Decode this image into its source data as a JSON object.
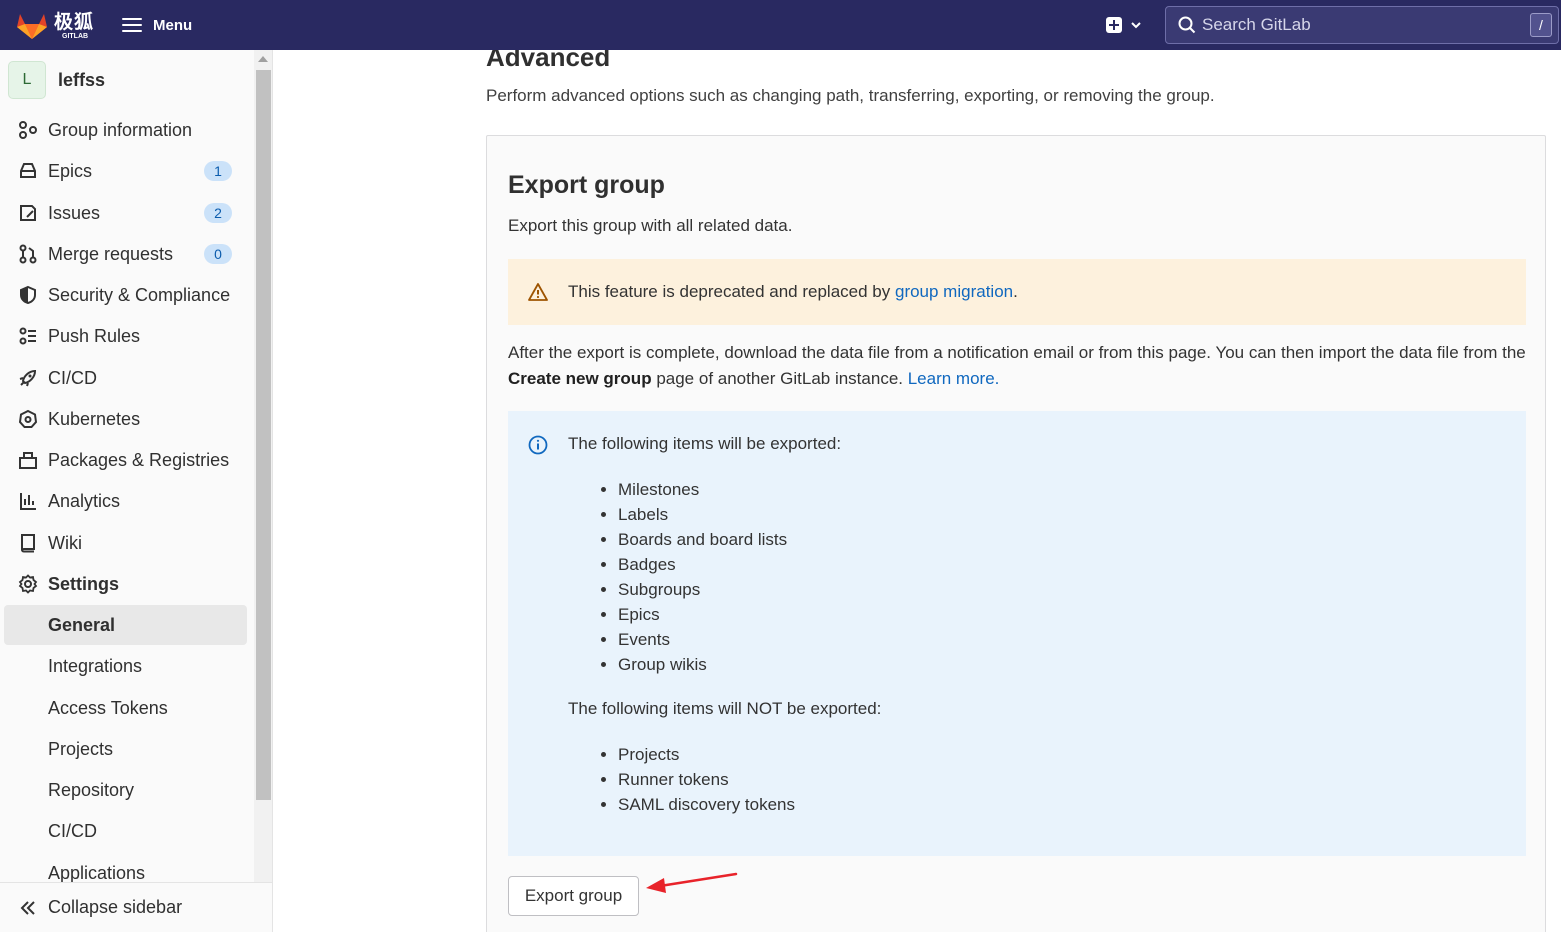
{
  "topbar": {
    "brand_cn": "极狐",
    "brand_en": "GITLAB",
    "menu_label": "Menu",
    "search_placeholder": "Search GitLab",
    "search_shortcut": "/"
  },
  "sidebar": {
    "group_initial": "L",
    "group_name": "leffss",
    "items": [
      {
        "label": "Group information",
        "icon": "group-information-icon"
      },
      {
        "label": "Epics",
        "badge": "1",
        "icon": "epic-icon"
      },
      {
        "label": "Issues",
        "badge": "2",
        "icon": "issues-icon"
      },
      {
        "label": "Merge requests",
        "badge": "0",
        "icon": "merge-request-icon"
      },
      {
        "label": "Security & Compliance",
        "icon": "shield-icon"
      },
      {
        "label": "Push Rules",
        "icon": "push-rules-icon"
      },
      {
        "label": "CI/CD",
        "icon": "rocket-icon"
      },
      {
        "label": "Kubernetes",
        "icon": "kubernetes-icon"
      },
      {
        "label": "Packages & Registries",
        "icon": "package-icon"
      },
      {
        "label": "Analytics",
        "icon": "chart-icon"
      },
      {
        "label": "Wiki",
        "icon": "book-icon"
      },
      {
        "label": "Settings",
        "icon": "settings-icon"
      }
    ],
    "sub_items": [
      {
        "label": "General"
      },
      {
        "label": "Integrations"
      },
      {
        "label": "Access Tokens"
      },
      {
        "label": "Projects"
      },
      {
        "label": "Repository"
      },
      {
        "label": "CI/CD"
      },
      {
        "label": "Applications"
      }
    ],
    "collapse_label": "Collapse sidebar"
  },
  "main": {
    "section_title": "Advanced",
    "section_desc": "Perform advanced options such as changing path, transferring, exporting, or removing the group.",
    "card": {
      "title": "Export group",
      "desc": "Export this group with all related data.",
      "warning_text": "This feature is deprecated and replaced by ",
      "warning_link": "group migration",
      "warning_end": ".",
      "para_1": "After the export is complete, download the data file from a notification email or from this page. You can then import the data file from the ",
      "para_bold": "Create new group",
      "para_2": " page of another GitLab instance. ",
      "para_link": "Learn more.",
      "exported_head": "The following items will be exported:",
      "exported": [
        "Milestones",
        "Labels",
        "Boards and board lists",
        "Badges",
        "Subgroups",
        "Epics",
        "Events",
        "Group wikis"
      ],
      "not_exported_head": "The following items will NOT be exported:",
      "not_exported": [
        "Projects",
        "Runner tokens",
        "SAML discovery tokens"
      ],
      "button_label": "Export group"
    }
  },
  "colors": {
    "topbar": "#292961",
    "link": "#1068bf",
    "warning_bg": "#fdf1dd",
    "info_bg": "#e9f3fc",
    "annotation_arrow": "#e8232a"
  }
}
